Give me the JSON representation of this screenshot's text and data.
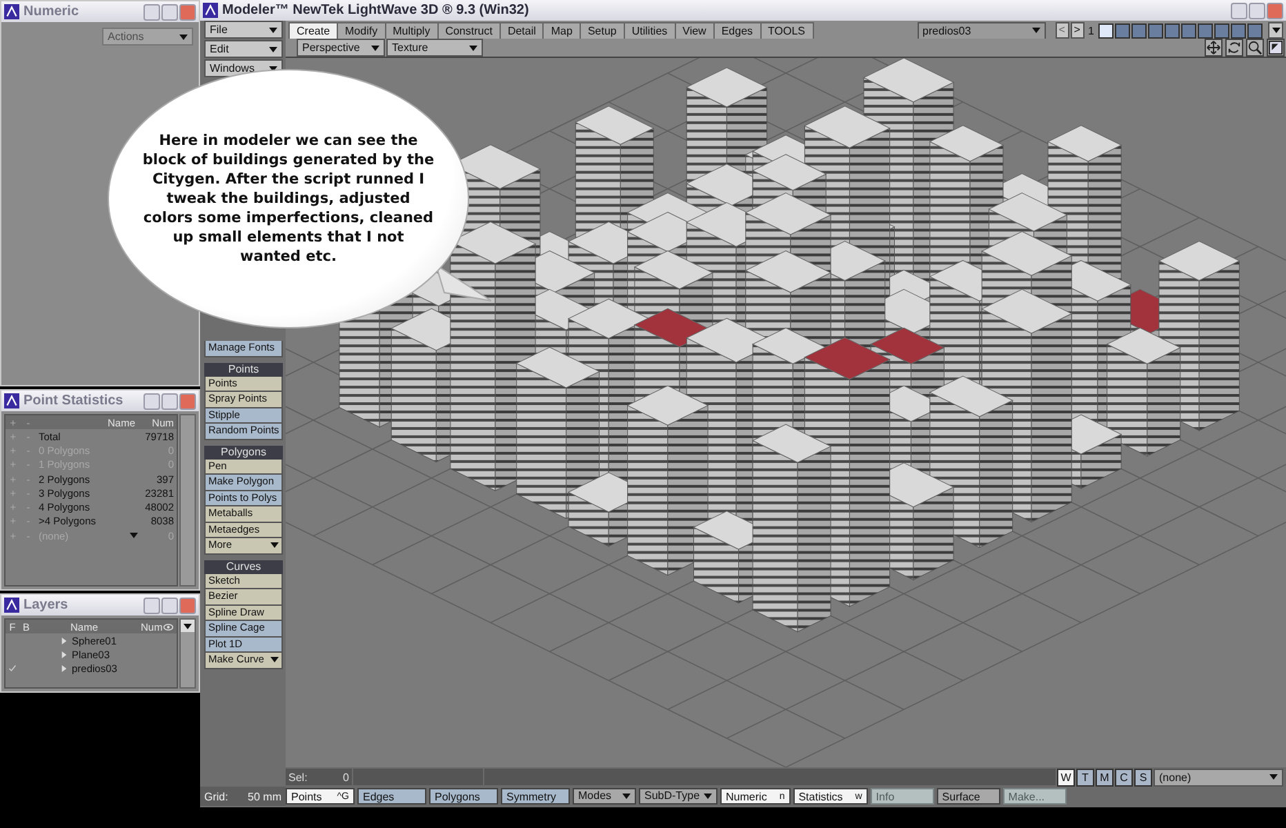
{
  "numeric_panel": {
    "title": "Numeric",
    "actions": {
      "label": "Actions",
      "disabled": true
    }
  },
  "point_statistics": {
    "title": "Point Statistics",
    "columns": [
      "+",
      "-",
      "Name",
      "Num"
    ],
    "rows": [
      {
        "add": "+",
        "remove": "-",
        "name": "Total",
        "num": "79718",
        "disabled": false,
        "kind": "row"
      },
      {
        "add": "+",
        "remove": "-",
        "name": "0 Polygons",
        "num": "0",
        "disabled": true,
        "kind": "row"
      },
      {
        "add": "+",
        "remove": "-",
        "name": "1 Polygons",
        "num": "0",
        "disabled": true,
        "kind": "row"
      },
      {
        "add": "+",
        "remove": "-",
        "name": "2 Polygons",
        "num": "397",
        "disabled": false,
        "kind": "row"
      },
      {
        "add": "+",
        "remove": "-",
        "name": "3 Polygons",
        "num": "23281",
        "disabled": false,
        "kind": "row"
      },
      {
        "add": "+",
        "remove": "-",
        "name": "4 Polygons",
        "num": "48002",
        "disabled": false,
        "kind": "row"
      },
      {
        "add": "+",
        "remove": "-",
        "name": ">4 Polygons",
        "num": "8038",
        "disabled": false,
        "kind": "row"
      },
      {
        "add": "+",
        "remove": "-",
        "name": "(none)",
        "num": "0",
        "disabled": true,
        "kind": "dropdown"
      }
    ]
  },
  "layers": {
    "title": "Layers",
    "columns": [
      "F",
      "B",
      "Name",
      "Num"
    ],
    "rows": [
      {
        "name": "Sphere01",
        "checked": false
      },
      {
        "name": "Plane03",
        "checked": false
      },
      {
        "name": "predios03",
        "checked": true
      }
    ]
  },
  "window": {
    "title": "Modeler™ NewTek LightWave 3D ® 9.3 (Win32)"
  },
  "menus": [
    "File",
    "Edit",
    "Windows"
  ],
  "tabs": [
    {
      "label": "Create",
      "selected": true
    },
    {
      "label": "Modify",
      "selected": false
    },
    {
      "label": "Multiply",
      "selected": false
    },
    {
      "label": "Construct",
      "selected": false
    },
    {
      "label": "Detail",
      "selected": false
    },
    {
      "label": "Map",
      "selected": false
    },
    {
      "label": "Setup",
      "selected": false
    },
    {
      "label": "Utilities",
      "selected": false
    },
    {
      "label": "View",
      "selected": false
    },
    {
      "label": "Edges",
      "selected": false
    },
    {
      "label": "TOOLS",
      "selected": false
    }
  ],
  "layer_select": "predios03",
  "layer_prev": "<",
  "layer_next": ">",
  "layer_page": "1",
  "layer_slots": [
    {
      "active": true
    },
    {
      "active": false
    },
    {
      "active": false
    },
    {
      "active": false
    },
    {
      "active": false
    },
    {
      "active": false
    },
    {
      "active": false
    },
    {
      "active": false
    },
    {
      "active": false
    },
    {
      "active": false
    }
  ],
  "viewport": {
    "view": "Perspective",
    "render_mode": "Texture"
  },
  "tool_groups": [
    {
      "items": [
        {
          "label": "Manage Fonts",
          "color": "#a9b9cc",
          "dropdown": false
        }
      ]
    },
    {
      "title": "Points",
      "items": [
        {
          "label": "Points",
          "color": "#c9c6b2",
          "dropdown": false
        },
        {
          "label": "Spray Points",
          "color": "#c9c6b2",
          "dropdown": false
        },
        {
          "label": "Stipple",
          "color": "#a9b9cc",
          "dropdown": false
        },
        {
          "label": "Random Points",
          "color": "#a9b9cc",
          "dropdown": false
        }
      ]
    },
    {
      "title": "Polygons",
      "items": [
        {
          "label": "Pen",
          "color": "#c9c6b2",
          "dropdown": false
        },
        {
          "label": "Make Polygon",
          "color": "#a9b9cc",
          "dropdown": false
        },
        {
          "label": "Points to Polys",
          "color": "#a9b9cc",
          "dropdown": false
        },
        {
          "label": "Metaballs",
          "color": "#c9c6b2",
          "dropdown": false
        },
        {
          "label": "Metaedges",
          "color": "#c9c6b2",
          "dropdown": false
        },
        {
          "label": "More",
          "color": "#c9c6b2",
          "dropdown": true
        }
      ]
    },
    {
      "title": "Curves",
      "items": [
        {
          "label": "Sketch",
          "color": "#c9c6b2",
          "dropdown": false
        },
        {
          "label": "Bezier",
          "color": "#c9c6b2",
          "dropdown": false
        },
        {
          "label": "Spline Draw",
          "color": "#c9c6b2",
          "dropdown": false
        },
        {
          "label": "Spline Cage",
          "color": "#a9b9cc",
          "dropdown": false
        },
        {
          "label": "Plot 1D",
          "color": "#a9b9cc",
          "dropdown": false
        },
        {
          "label": "Make Curve",
          "color": "#c9c6b2",
          "dropdown": true
        }
      ]
    }
  ],
  "bubble_text": "Here in modeler we can see the block of buildings generated by the Citygen. After the script runned I tweak the buildings, adjusted colors some imperfections, cleaned up small elements that I not wanted etc.",
  "selection": {
    "label": "Sel:",
    "value": "0"
  },
  "component_modes": [
    {
      "label": "W",
      "selected": true
    },
    {
      "label": "T",
      "selected": false
    },
    {
      "label": "M",
      "selected": false
    },
    {
      "label": "C",
      "selected": false
    },
    {
      "label": "S",
      "selected": false
    }
  ],
  "surface_select": "(none)",
  "grid": {
    "label": "Grid:",
    "value": "50 mm"
  },
  "bottom_buttons": [
    {
      "label": "Points",
      "shortcut": "^G",
      "kind": "mode",
      "selected": true
    },
    {
      "label": "Edges",
      "kind": "mode",
      "selected": false
    },
    {
      "label": "Polygons",
      "kind": "mode",
      "selected": false
    },
    {
      "label": "Symmetry",
      "kind": "toggle",
      "selected": false
    },
    {
      "label": "Modes",
      "kind": "menu"
    },
    {
      "label": "SubD-Type",
      "kind": "menu"
    },
    {
      "label": "Numeric",
      "shortcut": "n",
      "kind": "panel",
      "selected": true,
      "disabled": false
    },
    {
      "label": "Statistics",
      "shortcut": "w",
      "kind": "panel",
      "selected": true,
      "disabled": false
    },
    {
      "label": "Info",
      "kind": "panel",
      "selected": false,
      "disabled": true
    },
    {
      "label": "Surface",
      "kind": "panel",
      "selected": false,
      "disabled": false
    },
    {
      "label": "Make...",
      "kind": "panel",
      "selected": false,
      "disabled": true
    }
  ]
}
